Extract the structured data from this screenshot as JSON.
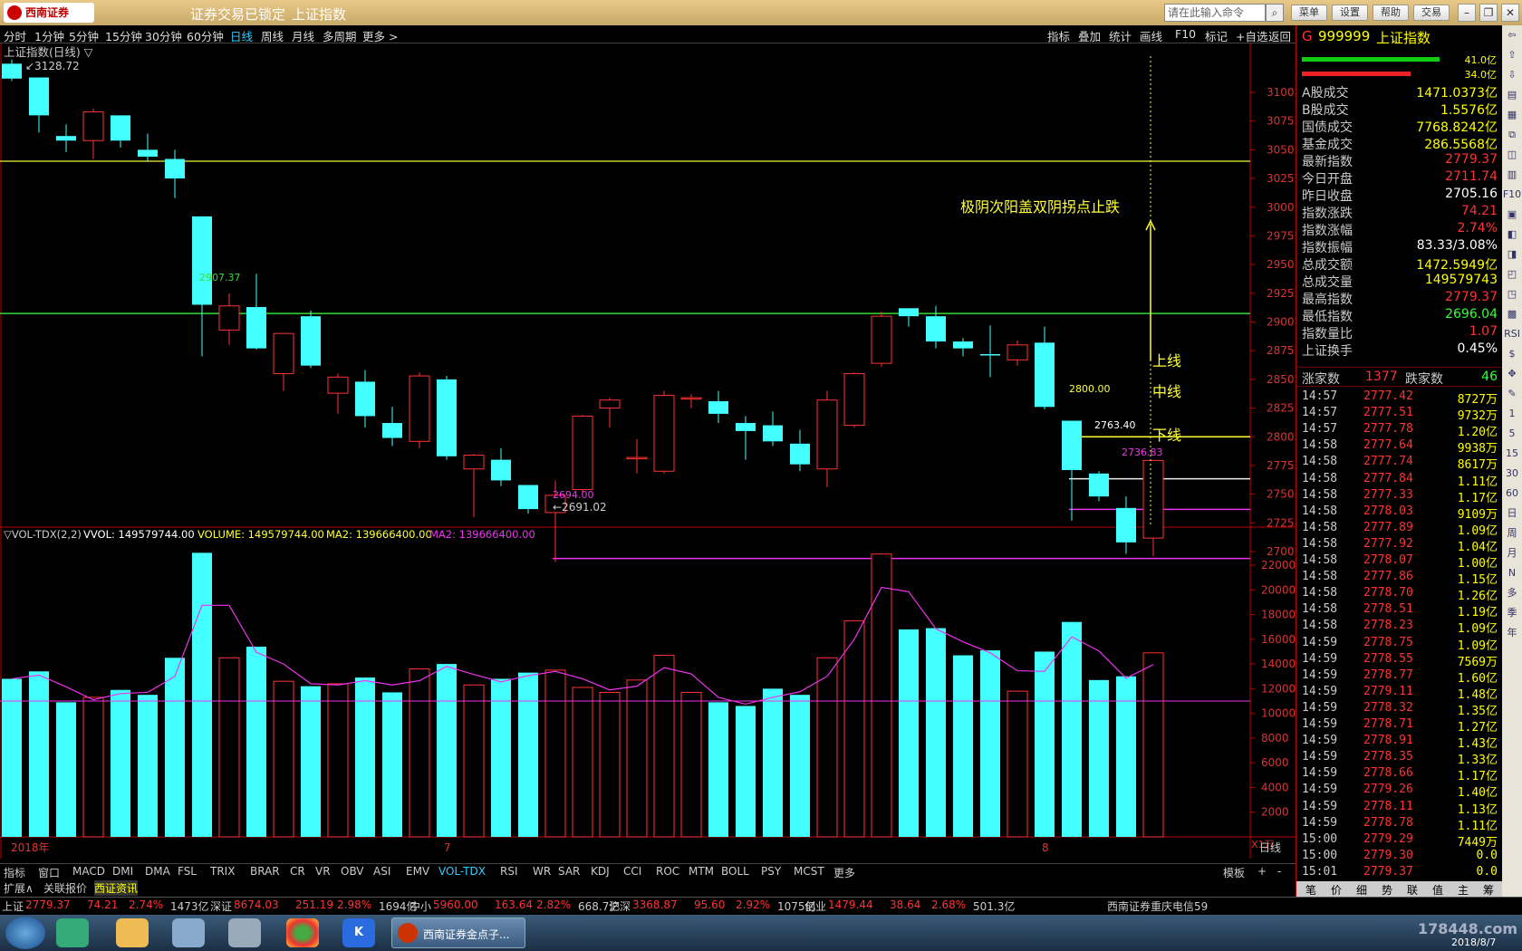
{
  "window": {
    "status_locked": "证券交易已锁定",
    "index_name": "上证指数",
    "logo_text": "西南证券",
    "command_placeholder": "请在此输入命令",
    "buttons": [
      "菜单",
      "设置",
      "帮助",
      "交易"
    ]
  },
  "period_bar": {
    "items": [
      "分时",
      "1分钟",
      "5分钟",
      "15分钟",
      "30分钟",
      "60分钟",
      "日线",
      "周线",
      "月线",
      "多周期",
      "更多 >"
    ],
    "active": "日线",
    "right_items": [
      "指标",
      "叠加",
      "统计",
      "画线",
      "F10",
      "标记",
      "+自选",
      "返回"
    ]
  },
  "chart_data": {
    "type": "candlestick",
    "title": "上证指数(日线) ▽",
    "high_label": "3128.72",
    "low_label": "2691.02",
    "annotation_main": "极阴次阳盖双阴拐点止跌",
    "line_labels": {
      "upper": "上线",
      "middle": "中线",
      "lower": "下线"
    },
    "price_marks": [
      "2907.37",
      "2800.00",
      "2763.40",
      "2736.83",
      "2694.00"
    ],
    "horizontal_lines": [
      {
        "price": 3040,
        "color": "#cccc33"
      },
      {
        "price": 2907.37,
        "color": "#33dd33"
      },
      {
        "price": 2800,
        "color": "#ffff33"
      },
      {
        "price": 2763.4,
        "color": "#eeeeee"
      },
      {
        "price": 2736.83,
        "color": "#ee33ee"
      },
      {
        "price": 2694,
        "color": "#ee33ee"
      }
    ],
    "y_ticks": [
      3100,
      3075,
      3050,
      3025,
      3000,
      2975,
      2950,
      2925,
      2900,
      2875,
      2850,
      2825,
      2800,
      2775,
      2750,
      2725,
      2700
    ],
    "ylim": [
      2680,
      3135
    ],
    "candles": [
      {
        "o": 3125,
        "c": 3112,
        "h": 3128.72,
        "l": 3110
      },
      {
        "o": 3113,
        "c": 3080,
        "h": 3113,
        "l": 3065
      },
      {
        "o": 3062,
        "c": 3058,
        "h": 3072,
        "l": 3048
      },
      {
        "o": 3058,
        "c": 3083,
        "h": 3086,
        "l": 3042
      },
      {
        "o": 3080,
        "c": 3058,
        "h": 3080,
        "l": 3052
      },
      {
        "o": 3050,
        "c": 3044,
        "h": 3064,
        "l": 3040
      },
      {
        "o": 3042,
        "c": 3025,
        "h": 3050,
        "l": 3008
      },
      {
        "o": 2992,
        "c": 2915,
        "h": 2992,
        "l": 2870
      },
      {
        "o": 2893,
        "c": 2914,
        "h": 2925,
        "l": 2880
      },
      {
        "o": 2913,
        "c": 2877,
        "h": 2942,
        "l": 2876
      },
      {
        "o": 2855,
        "c": 2890,
        "h": 2890,
        "l": 2840
      },
      {
        "o": 2905,
        "c": 2862,
        "h": 2910,
        "l": 2860
      },
      {
        "o": 2838,
        "c": 2852,
        "h": 2855,
        "l": 2820
      },
      {
        "o": 2848,
        "c": 2818,
        "h": 2858,
        "l": 2808
      },
      {
        "o": 2812,
        "c": 2799,
        "h": 2826,
        "l": 2792
      },
      {
        "o": 2796,
        "c": 2853,
        "h": 2856,
        "l": 2790
      },
      {
        "o": 2850,
        "c": 2783,
        "h": 2853,
        "l": 2780
      },
      {
        "o": 2772,
        "c": 2784,
        "h": 2785,
        "l": 2730
      },
      {
        "o": 2780,
        "c": 2762,
        "h": 2790,
        "l": 2757
      },
      {
        "o": 2758,
        "c": 2737,
        "h": 2758,
        "l": 2733
      },
      {
        "o": 2734,
        "c": 2749,
        "h": 2762,
        "l": 2691.02
      },
      {
        "o": 2754,
        "c": 2818,
        "h": 2819,
        "l": 2750
      },
      {
        "o": 2825,
        "c": 2832,
        "h": 2834,
        "l": 2808
      },
      {
        "o": 2781,
        "c": 2782,
        "h": 2798,
        "l": 2768
      },
      {
        "o": 2770,
        "c": 2836,
        "h": 2840,
        "l": 2768
      },
      {
        "o": 2834,
        "c": 2834,
        "h": 2837,
        "l": 2825
      },
      {
        "o": 2831,
        "c": 2820,
        "h": 2840,
        "l": 2812
      },
      {
        "o": 2812,
        "c": 2805,
        "h": 2818,
        "l": 2780
      },
      {
        "o": 2810,
        "c": 2796,
        "h": 2822,
        "l": 2792
      },
      {
        "o": 2794,
        "c": 2776,
        "h": 2806,
        "l": 2770
      },
      {
        "o": 2772,
        "c": 2832,
        "h": 2840,
        "l": 2756
      },
      {
        "o": 2810,
        "c": 2855,
        "h": 2856,
        "l": 2808
      },
      {
        "o": 2864,
        "c": 2905,
        "h": 2909,
        "l": 2861
      },
      {
        "o": 2912,
        "c": 2905,
        "h": 2912,
        "l": 2896
      },
      {
        "o": 2905,
        "c": 2883,
        "h": 2914,
        "l": 2877
      },
      {
        "o": 2883,
        "c": 2877,
        "h": 2886,
        "l": 2870
      },
      {
        "o": 2872,
        "c": 2871,
        "h": 2897,
        "l": 2852
      },
      {
        "o": 2867,
        "c": 2880,
        "h": 2884,
        "l": 2862
      },
      {
        "o": 2882,
        "c": 2826,
        "h": 2896,
        "l": 2824
      },
      {
        "o": 2814,
        "c": 2771,
        "h": 2814,
        "l": 2727
      },
      {
        "o": 2768,
        "c": 2748,
        "h": 2770,
        "l": 2744
      },
      {
        "o": 2738,
        "c": 2708,
        "h": 2748,
        "l": 2698
      },
      {
        "o": 2711.74,
        "c": 2779.37,
        "h": 2779.37,
        "l": 2696.04
      }
    ],
    "volume": {
      "label": "▽VOL-TDX(2,2)",
      "vvol": "VVOL: 149579744.00",
      "volume_text": "VOLUME: 149579744.00",
      "ma2_text": "MA2: 139666400.00",
      "ma2b_text": "MA2: 139666400.00",
      "unit": "X1万",
      "y_ticks": [
        22000,
        20000,
        18000,
        16000,
        14000,
        12000,
        10000,
        8000,
        6000,
        4000,
        2000
      ],
      "ylim": [
        0,
        23500
      ],
      "values": [
        12800,
        13400,
        10900,
        11300,
        11900,
        11500,
        14500,
        23000,
        14500,
        15400,
        12600,
        12200,
        12400,
        12900,
        11700,
        13600,
        14000,
        12300,
        12800,
        13300,
        13500,
        12100,
        11700,
        12700,
        14700,
        11700,
        10900,
        10600,
        12000,
        11500,
        14500,
        17500,
        22900,
        16800,
        16900,
        14700,
        15100,
        11800,
        15000,
        17400,
        12700,
        13000,
        14900
      ],
      "ma": [
        12800,
        13100,
        12150,
        11100,
        11600,
        11700,
        13000,
        18750,
        18750,
        14950,
        14000,
        12400,
        12300,
        12650,
        12300,
        12650,
        13800,
        13150,
        12550,
        13050,
        13400,
        12800,
        11900,
        12200,
        13700,
        13200,
        11300,
        10750,
        11300,
        11750,
        13000,
        16000,
        20200,
        19850,
        16850,
        15800,
        14900,
        13450,
        13400,
        16200,
        15050,
        12850,
        13950
      ],
      "reference_line": 11000
    },
    "x_labels": [
      "2018年",
      "7",
      "8"
    ]
  },
  "indicator_tabs": {
    "items": [
      "指标",
      "窗口",
      "MACD",
      "DMI",
      "DMA",
      "FSL",
      "TRIX",
      "BRAR",
      "CR",
      "VR",
      "OBV",
      "ASI",
      "EMV",
      "VOL-TDX",
      "RSI",
      "WR",
      "SAR",
      "KDJ",
      "CCI",
      "ROC",
      "MTM",
      "BOLL",
      "PSY",
      "MCST",
      "更多"
    ],
    "active": "VOL-TDX",
    "right": [
      "模板",
      "+",
      "-"
    ]
  },
  "bottom_tabs": {
    "items": [
      "扩展∧",
      "关联报价",
      "西证资讯"
    ],
    "active": "西证资讯"
  },
  "status_bar": {
    "items": [
      {
        "n": "上证",
        "v": "2779.37",
        "c": "74.21",
        "p": "2.74%",
        "a": "1473亿"
      },
      {
        "n": "深证",
        "v": "8674.03",
        "c": "251.19",
        "p": "2.98%",
        "a": "1694亿"
      },
      {
        "n": "中小",
        "v": "5960.00",
        "c": "163.64",
        "p": "2.82%",
        "a": "668.7亿"
      },
      {
        "n": "沪深",
        "v": "3368.87",
        "c": "95.60",
        "p": "2.92%",
        "a": "1075亿"
      },
      {
        "n": "创业",
        "v": "1479.44",
        "c": "38.64",
        "p": "2.68%",
        "a": "501.3亿"
      }
    ],
    "broker": "西南证券重庆电信59"
  },
  "right_panel": {
    "code": "999999",
    "name": "上证指数",
    "bar1_label": "41.0亿",
    "bar2_label": "34.0亿",
    "stats": [
      {
        "l": "A股成交",
        "v": "1471.0373亿",
        "c": "#ff0"
      },
      {
        "l": "B股成交",
        "v": "1.5576亿",
        "c": "#ff0"
      },
      {
        "l": "国债成交",
        "v": "7768.8242亿",
        "c": "#ff0"
      },
      {
        "l": "基金成交",
        "v": "286.5568亿",
        "c": "#ff0"
      },
      {
        "l": "最新指数",
        "v": "2779.37",
        "c": "#f33"
      },
      {
        "l": "今日开盘",
        "v": "2711.74",
        "c": "#f33"
      },
      {
        "l": "昨日收盘",
        "v": "2705.16",
        "c": "#fff"
      },
      {
        "l": "指数涨跌",
        "v": "74.21",
        "c": "#f33"
      },
      {
        "l": "指数涨幅",
        "v": "2.74%",
        "c": "#f33"
      },
      {
        "l": "指数振幅",
        "v": "83.33/3.08%",
        "c": "#fff"
      },
      {
        "l": "总成交额",
        "v": "1472.5949亿",
        "c": "#ff0"
      },
      {
        "l": "总成交量",
        "v": "149579743",
        "c": "#ff0"
      },
      {
        "l": "最高指数",
        "v": "2779.37",
        "c": "#f33"
      },
      {
        "l": "最低指数",
        "v": "2696.04",
        "c": "#3f3"
      },
      {
        "l": "指数量比",
        "v": "1.07",
        "c": "#f33"
      },
      {
        "l": "上证换手",
        "v": "0.45%",
        "c": "#fff"
      }
    ],
    "up_label": "涨家数",
    "up_count": "1377",
    "down_label": "跌家数",
    "down_count": "46",
    "ticks": [
      [
        "14:57",
        "2777.42",
        "8727万"
      ],
      [
        "14:57",
        "2777.51",
        "9732万"
      ],
      [
        "14:57",
        "2777.78",
        "1.20亿"
      ],
      [
        "14:58",
        "2777.64",
        "9938万"
      ],
      [
        "14:58",
        "2777.74",
        "8617万"
      ],
      [
        "14:58",
        "2777.84",
        "1.11亿"
      ],
      [
        "14:58",
        "2777.33",
        "1.17亿"
      ],
      [
        "14:58",
        "2778.03",
        "9109万"
      ],
      [
        "14:58",
        "2777.89",
        "1.09亿"
      ],
      [
        "14:58",
        "2777.92",
        "1.04亿"
      ],
      [
        "14:58",
        "2778.07",
        "1.00亿"
      ],
      [
        "14:58",
        "2777.86",
        "1.15亿"
      ],
      [
        "14:58",
        "2778.70",
        "1.26亿"
      ],
      [
        "14:58",
        "2778.51",
        "1.19亿"
      ],
      [
        "14:58",
        "2778.23",
        "1.09亿"
      ],
      [
        "14:59",
        "2778.75",
        "1.09亿"
      ],
      [
        "14:59",
        "2778.55",
        "7569万"
      ],
      [
        "14:59",
        "2778.77",
        "1.60亿"
      ],
      [
        "14:59",
        "2779.11",
        "1.48亿"
      ],
      [
        "14:59",
        "2778.32",
        "1.35亿"
      ],
      [
        "14:59",
        "2778.71",
        "1.27亿"
      ],
      [
        "14:59",
        "2778.91",
        "1.43亿"
      ],
      [
        "14:59",
        "2778.35",
        "1.33亿"
      ],
      [
        "14:59",
        "2778.66",
        "1.17亿"
      ],
      [
        "14:59",
        "2779.26",
        "1.40亿"
      ],
      [
        "14:59",
        "2778.11",
        "1.13亿"
      ],
      [
        "14:59",
        "2778.78",
        "1.11亿"
      ],
      [
        "15:00",
        "2779.29",
        "7449万"
      ],
      [
        "15:00",
        "2779.30",
        "0.0"
      ],
      [
        "15:01",
        "2779.37",
        "0.0"
      ]
    ],
    "bottom_tabs": [
      "笔",
      "价",
      "细",
      "势",
      "联",
      "值",
      "主",
      "筹"
    ]
  },
  "right_toolbar": [
    "1",
    "5",
    "15",
    "30",
    "60",
    "日",
    "周",
    "月",
    "N",
    "多",
    "季",
    "年"
  ],
  "taskbar": {
    "active_app": "西南证券金点子...",
    "watermark": "178448.com",
    "date": "2018/8/7"
  },
  "colors": {
    "up": "#f33",
    "down": "#4ff",
    "bg": "#000"
  }
}
